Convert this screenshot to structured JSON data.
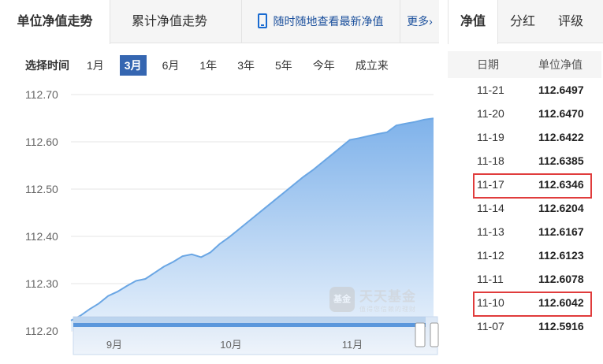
{
  "tabs": {
    "unit_nav": "单位净值走势",
    "cumulative_nav": "累计净值走势",
    "app_promo": "随时随地查看最新净值",
    "more": "更多",
    "more_icon": "chevron-right-icon",
    "app_icon": "phone-icon"
  },
  "range": {
    "label": "选择时间",
    "options": [
      "1月",
      "3月",
      "6月",
      "1年",
      "3年",
      "5年",
      "今年",
      "成立来"
    ],
    "selected": "3月"
  },
  "watermark": {
    "logo": "基金",
    "title": "天天基金",
    "subtitle": "值得您信赖的理财"
  },
  "colors": {
    "accent": "#3566b1",
    "line": "#6aa6e4",
    "area_top": "#7fb2ea",
    "area_bottom": "#e6f0fb",
    "highlight": "#e03c3c"
  },
  "right_tabs": {
    "nav": "净值",
    "dividend": "分红",
    "rating": "评级"
  },
  "nav_table": {
    "headers": [
      "日期",
      "单位净值"
    ],
    "rows": [
      {
        "date": "11-21",
        "value": "112.6497",
        "highlight": false
      },
      {
        "date": "11-20",
        "value": "112.6470",
        "highlight": false
      },
      {
        "date": "11-19",
        "value": "112.6422",
        "highlight": false
      },
      {
        "date": "11-18",
        "value": "112.6385",
        "highlight": false
      },
      {
        "date": "11-17",
        "value": "112.6346",
        "highlight": true
      },
      {
        "date": "11-14",
        "value": "112.6204",
        "highlight": false
      },
      {
        "date": "11-13",
        "value": "112.6167",
        "highlight": false
      },
      {
        "date": "11-12",
        "value": "112.6123",
        "highlight": false
      },
      {
        "date": "11-11",
        "value": "112.6078",
        "highlight": false
      },
      {
        "date": "11-10",
        "value": "112.6042",
        "highlight": true
      },
      {
        "date": "11-07",
        "value": "112.5916",
        "highlight": false
      }
    ]
  },
  "chart_data": {
    "type": "area",
    "title": "",
    "xlabel": "",
    "ylabel": "",
    "ylim": [
      112.2,
      112.7
    ],
    "yticks": [
      "112.70",
      "112.60",
      "112.50",
      "112.40",
      "112.30",
      "112.20"
    ],
    "ytick_values": [
      112.7,
      112.6,
      112.5,
      112.4,
      112.3,
      112.2
    ],
    "navigator_labels": [
      "9月",
      "10月",
      "11月"
    ],
    "grid": true,
    "series": [
      {
        "values": [
          112.222,
          112.232,
          112.246,
          112.258,
          112.274,
          112.283,
          112.295,
          112.306,
          112.31,
          112.323,
          112.336,
          112.346,
          112.358,
          112.362,
          112.356,
          112.366,
          112.384,
          112.398,
          112.414,
          112.43,
          112.446,
          112.462,
          112.478,
          112.494,
          112.51,
          112.526,
          112.54,
          112.556,
          112.572,
          112.588,
          112.6042,
          112.6078,
          112.6123,
          112.6167,
          112.6204,
          112.6346,
          112.6385,
          112.6422,
          112.647,
          112.6497
        ]
      }
    ]
  }
}
